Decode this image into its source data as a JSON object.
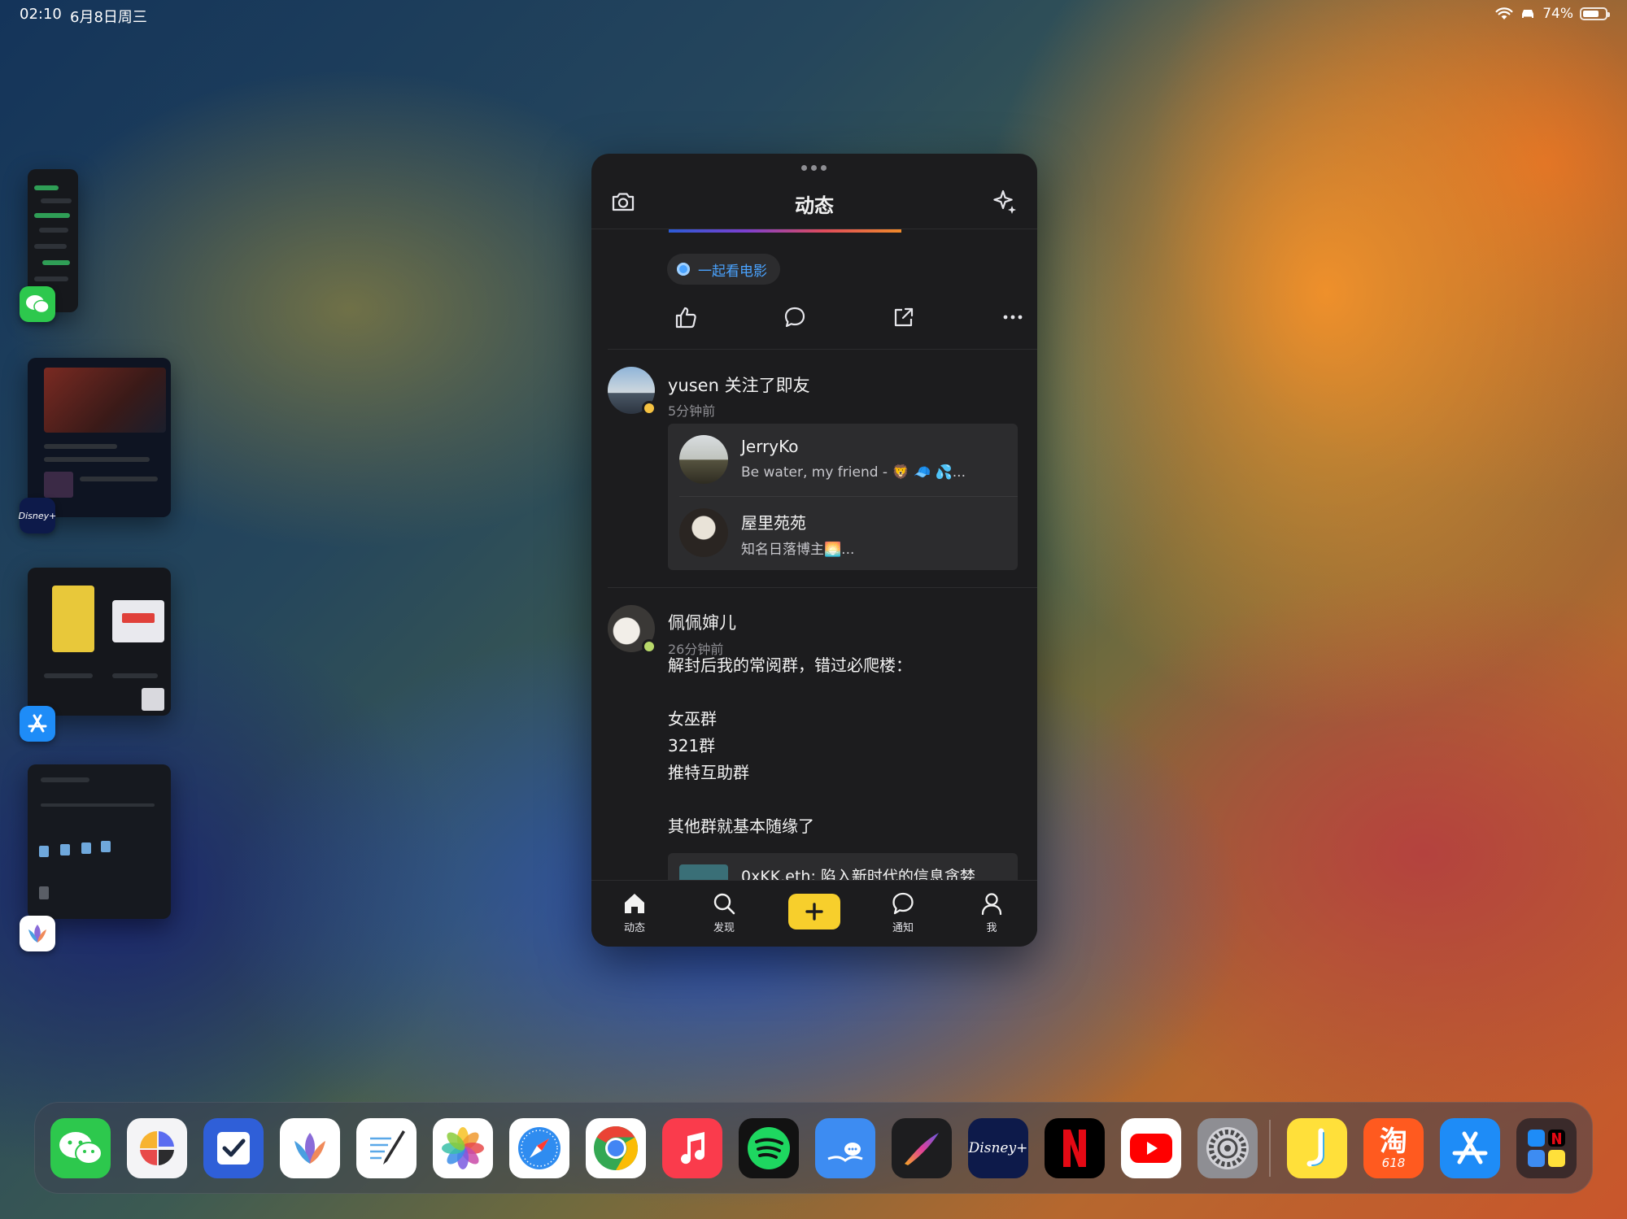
{
  "status_bar": {
    "time": "02:10",
    "date": "6月8日周三",
    "battery": "74%",
    "battery_level": 0.74
  },
  "shelf": [
    {
      "app": "WeChat",
      "icon": "wechat-icon"
    },
    {
      "app": "Disney+",
      "icon": "disney-plus-icon"
    },
    {
      "app": "App Store",
      "icon": "app-store-icon"
    },
    {
      "app": "MindNode",
      "icon": "mindnode-icon"
    }
  ],
  "window": {
    "title": "动态",
    "left_icon": "camera-icon",
    "right_icon": "sparkle-icon"
  },
  "feed": {
    "topic_chip": "一起看电影",
    "follow_post": {
      "user": "yusen",
      "action": "关注了即友",
      "time": "5分钟前",
      "followed": [
        {
          "name": "JerryKo",
          "bio": "Be water, my friend - 🦁 🧢 💦..."
        },
        {
          "name": "屋里苑苑",
          "bio": "知名日落博主🌅..."
        }
      ]
    },
    "text_post": {
      "user": "佩佩婶儿",
      "time": "26分钟前",
      "lines": [
        "解封后我的常阅群，错过必爬楼：",
        "",
        "女巫群",
        "321群",
        "推特互助群",
        "",
        "其他群就基本随缘了"
      ],
      "link_preview": "0xKK.eth: 陷入新时代的信息贪婪"
    }
  },
  "tabs": [
    {
      "label": "动态",
      "icon": "home-icon",
      "active": true
    },
    {
      "label": "发现",
      "icon": "search-icon"
    },
    {
      "label": "",
      "icon": "plus-icon"
    },
    {
      "label": "通知",
      "icon": "chat-bubble-icon"
    },
    {
      "label": "我",
      "icon": "person-icon"
    }
  ],
  "dock": [
    {
      "app": "WeChat",
      "icon": "wechat-icon",
      "color": "#2dc84d"
    },
    {
      "app": "Craft",
      "icon": "craft-icon",
      "color": "#f4f4f6"
    },
    {
      "app": "Things",
      "icon": "checkbox-icon",
      "color": "#2f5fd8"
    },
    {
      "app": "MindNode",
      "icon": "mindnode-icon",
      "color": "#ffffff"
    },
    {
      "app": "GoodNotes",
      "icon": "notes-pen-icon",
      "color": "#ffffff"
    },
    {
      "app": "Photos",
      "icon": "photos-flower-icon",
      "color": "#ffffff"
    },
    {
      "app": "Safari",
      "icon": "compass-icon",
      "color": "#ffffff"
    },
    {
      "app": "Chrome",
      "icon": "chrome-icon",
      "color": "#ffffff"
    },
    {
      "app": "Music",
      "icon": "music-note-icon",
      "color": "#fa3b4c"
    },
    {
      "app": "Spotify",
      "icon": "spotify-icon",
      "color": "#121212"
    },
    {
      "app": "Feedback",
      "icon": "book-chat-icon",
      "color": "#3d8cf2"
    },
    {
      "app": "Procreate",
      "icon": "brush-icon",
      "color": "#1d1d1f"
    },
    {
      "app": "Disney+",
      "icon": "disney-plus-icon",
      "color": "#0d1a4a"
    },
    {
      "app": "Netflix",
      "icon": "netflix-icon",
      "color": "#000000"
    },
    {
      "app": "YouTube",
      "icon": "youtube-icon",
      "color": "#ffffff"
    },
    {
      "app": "Settings",
      "icon": "gear-icon",
      "color": "#8e8e93"
    },
    {
      "app": "Jike",
      "icon": "jike-icon",
      "color": "#ffe03a"
    },
    {
      "app": "Taobao",
      "icon": "taobao-icon",
      "color": "#ff5a1f",
      "text": "淘",
      "sub": "618"
    },
    {
      "app": "App Store",
      "icon": "app-store-icon",
      "color": "#1e8cf7"
    },
    {
      "app": "App Library",
      "icon": "app-library-icon",
      "color": "#3a2a2a"
    }
  ]
}
